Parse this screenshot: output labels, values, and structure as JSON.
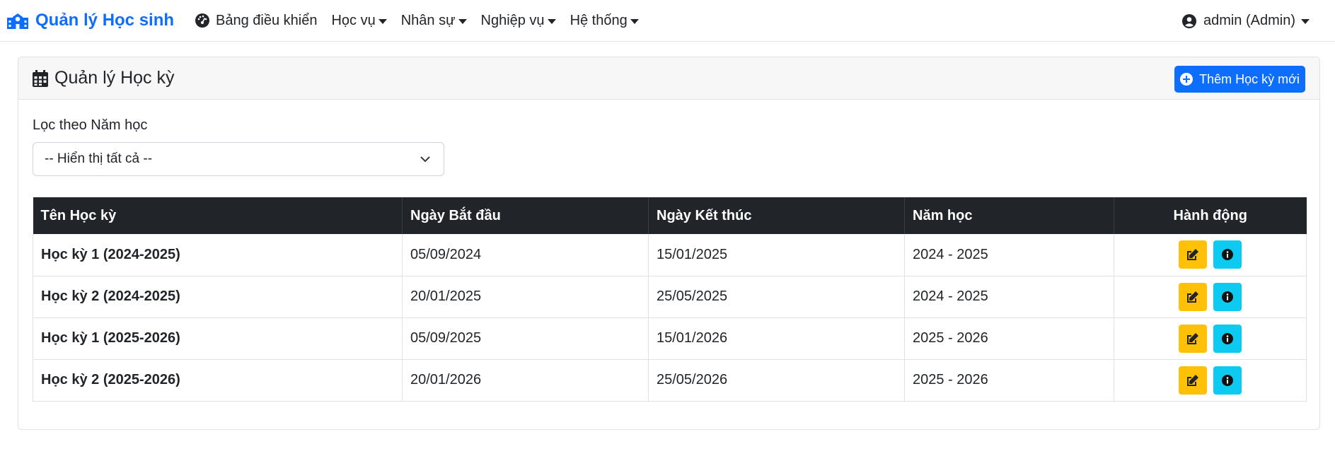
{
  "nav": {
    "brand": "Quản lý Học sinh",
    "dashboard": "Bảng điều khiển",
    "menus": [
      "Học vụ",
      "Nhân sự",
      "Nghiệp vụ",
      "Hệ thống"
    ],
    "user": "admin (Admin)"
  },
  "card": {
    "title": "Quản lý Học kỳ",
    "add_button": "Thêm Học kỳ mới"
  },
  "filter": {
    "label": "Lọc theo Năm học",
    "selected": "-- Hiển thị tất cả --"
  },
  "table": {
    "headers": [
      "Tên Học kỳ",
      "Ngày Bắt đầu",
      "Ngày Kết thúc",
      "Năm học",
      "Hành động"
    ],
    "rows": [
      {
        "name": "Học kỳ 1 (2024-2025)",
        "start": "05/09/2024",
        "end": "15/01/2025",
        "year": "2024 - 2025"
      },
      {
        "name": "Học kỳ 2 (2024-2025)",
        "start": "20/01/2025",
        "end": "25/05/2025",
        "year": "2024 - 2025"
      },
      {
        "name": "Học kỳ 1 (2025-2026)",
        "start": "05/09/2025",
        "end": "15/01/2026",
        "year": "2025 - 2026"
      },
      {
        "name": "Học kỳ 2 (2025-2026)",
        "start": "20/01/2026",
        "end": "25/05/2026",
        "year": "2025 - 2026"
      }
    ]
  },
  "colors": {
    "primary": "#0d6efd",
    "warning": "#ffc107",
    "info": "#0dcaf0",
    "table_header": "#212529"
  }
}
